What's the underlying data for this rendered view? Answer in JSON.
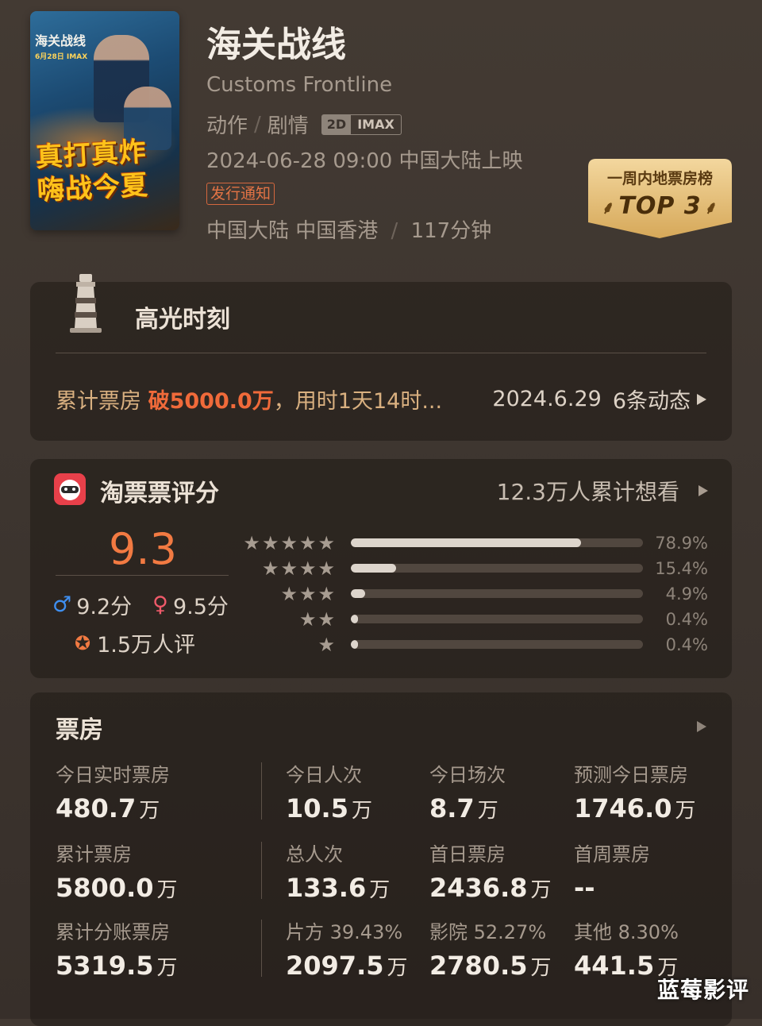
{
  "movie": {
    "title_cn": "海关战线",
    "title_en": "Customs Frontline",
    "genres": [
      "动作",
      "剧情"
    ],
    "formats": [
      "2D",
      "IMAX"
    ],
    "release": "2024-06-28 09:00 中国大陆上映",
    "notice_tag": "发行通知",
    "regions": "中国大陆 中国香港",
    "duration": "117分钟",
    "poster": {
      "title": "海关战线",
      "date": "6月28日 IMAX",
      "slogan_line1": "真打真炸",
      "slogan_line2": "嗨战今夏"
    }
  },
  "rank_badge": {
    "label": "一周内地票房榜",
    "value": "TOP 3"
  },
  "highlight": {
    "title": "高光时刻",
    "text_prefix": "累计票房 ",
    "text_emphasis": "破5000.0万",
    "text_suffix": "，用时1天14时...",
    "date": "2024.6.29",
    "updates": "6条动态"
  },
  "rating": {
    "title": "淘票票评分",
    "want_to_see": "12.3万人累计想看",
    "score": "9.3",
    "male_symbol": "♂",
    "male_score": "9.2分",
    "female_symbol": "♀",
    "female_score": "9.5分",
    "review_count": "1.5万人评",
    "distribution": [
      {
        "stars": "★★★★★",
        "percent_label": "78.9%",
        "percent": 78.9
      },
      {
        "stars": "★★★★",
        "percent_label": "15.4%",
        "percent": 15.4
      },
      {
        "stars": "★★★",
        "percent_label": "4.9%",
        "percent": 4.9
      },
      {
        "stars": "★★",
        "percent_label": "0.4%",
        "percent": 0.4
      },
      {
        "stars": "★",
        "percent_label": "0.4%",
        "percent": 0.4
      }
    ]
  },
  "box_office": {
    "title": "票房",
    "stats": [
      {
        "label": "今日实时票房",
        "value": "480.7",
        "unit": "万"
      },
      {
        "label": "今日人次",
        "value": "10.5",
        "unit": "万"
      },
      {
        "label": "今日场次",
        "value": "8.7",
        "unit": "万"
      },
      {
        "label": "预测今日票房",
        "value": "1746.0",
        "unit": "万"
      },
      {
        "label": "累计票房",
        "value": "5800.0",
        "unit": "万"
      },
      {
        "label": "总人次",
        "value": "133.6",
        "unit": "万"
      },
      {
        "label": "首日票房",
        "value": "2436.8",
        "unit": "万"
      },
      {
        "label": "首周票房",
        "value": "--",
        "unit": ""
      },
      {
        "label": "累计分账票房",
        "value": "5319.5",
        "unit": "万"
      },
      {
        "label": "片方 39.43%",
        "value": "2097.5",
        "unit": "万"
      },
      {
        "label": "影院 52.27%",
        "value": "2780.5",
        "unit": "万"
      },
      {
        "label": "其他 8.30%",
        "value": "441.5",
        "unit": "万"
      }
    ]
  },
  "watermark": "蓝莓影评",
  "colors": {
    "accent_orange": "#f06a3a",
    "gold_badge": "#e9c27a",
    "male_blue": "#3f8ff0",
    "female_red": "#f05a6a"
  }
}
